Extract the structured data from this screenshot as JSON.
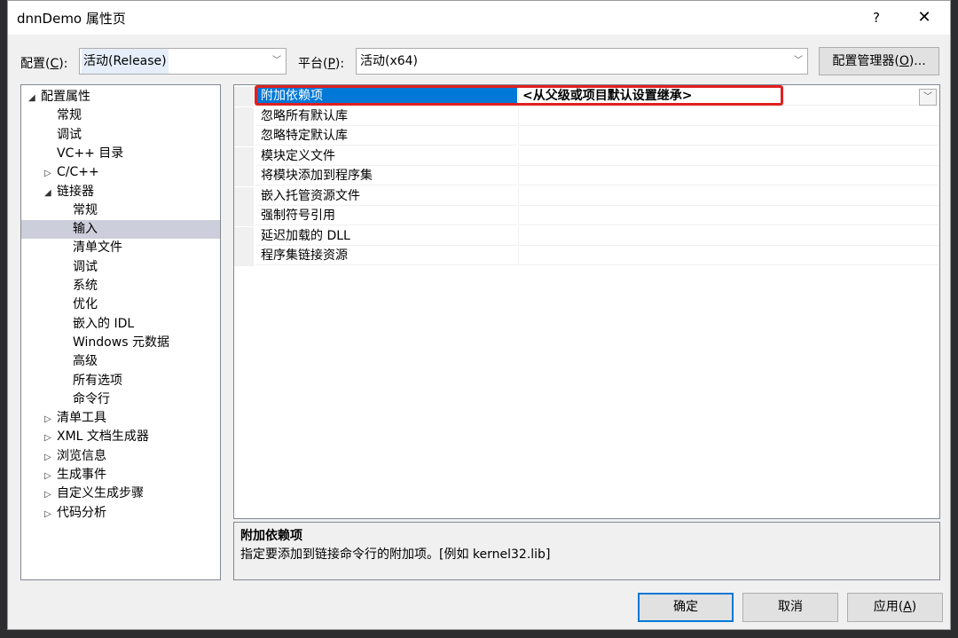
{
  "window": {
    "title": "dnnDemo 属性页",
    "help_label": "?",
    "close_label": "✕"
  },
  "toolbar": {
    "config_label": "配置(",
    "config_key": "C",
    "config_suffix": "):",
    "config_value": "活动(Release)",
    "platform_label": "平台(",
    "platform_key": "P",
    "platform_suffix": "):",
    "platform_value": "活动(x64)",
    "manager_label": "配置管理器(",
    "manager_key": "O",
    "manager_suffix": ")..."
  },
  "tree": {
    "items": [
      {
        "label": "配置属性",
        "exp": "◢",
        "level": 0
      },
      {
        "label": "常规",
        "exp": "",
        "level": 1
      },
      {
        "label": "调试",
        "exp": "",
        "level": 1
      },
      {
        "label": "VC++ 目录",
        "exp": "",
        "level": 1
      },
      {
        "label": "C/C++",
        "exp": "▷",
        "level": 1
      },
      {
        "label": "链接器",
        "exp": "◢",
        "level": 1
      },
      {
        "label": "常规",
        "exp": "",
        "level": 2
      },
      {
        "label": "输入",
        "exp": "",
        "level": 2,
        "selected": true
      },
      {
        "label": "清单文件",
        "exp": "",
        "level": 2
      },
      {
        "label": "调试",
        "exp": "",
        "level": 2
      },
      {
        "label": "系统",
        "exp": "",
        "level": 2
      },
      {
        "label": "优化",
        "exp": "",
        "level": 2
      },
      {
        "label": "嵌入的 IDL",
        "exp": "",
        "level": 2
      },
      {
        "label": "Windows 元数据",
        "exp": "",
        "level": 2
      },
      {
        "label": "高级",
        "exp": "",
        "level": 2
      },
      {
        "label": "所有选项",
        "exp": "",
        "level": 2
      },
      {
        "label": "命令行",
        "exp": "",
        "level": 2
      },
      {
        "label": "清单工具",
        "exp": "▷",
        "level": 1
      },
      {
        "label": "XML 文档生成器",
        "exp": "▷",
        "level": 1
      },
      {
        "label": "浏览信息",
        "exp": "▷",
        "level": 1
      },
      {
        "label": "生成事件",
        "exp": "▷",
        "level": 1
      },
      {
        "label": "自定义生成步骤",
        "exp": "▷",
        "level": 1
      },
      {
        "label": "代码分析",
        "exp": "▷",
        "level": 1
      }
    ]
  },
  "grid": {
    "rows": [
      {
        "name": "附加依赖项",
        "value": "<从父级或项目默认设置继承>",
        "selected": true
      },
      {
        "name": "忽略所有默认库",
        "value": ""
      },
      {
        "name": "忽略特定默认库",
        "value": ""
      },
      {
        "name": "模块定义文件",
        "value": ""
      },
      {
        "name": "将模块添加到程序集",
        "value": ""
      },
      {
        "name": "嵌入托管资源文件",
        "value": ""
      },
      {
        "name": "强制符号引用",
        "value": ""
      },
      {
        "name": "延迟加载的 DLL",
        "value": ""
      },
      {
        "name": "程序集链接资源",
        "value": ""
      }
    ]
  },
  "description": {
    "title": "附加依赖项",
    "text": "指定要添加到链接命令行的附加项。[例如 kernel32.lib]"
  },
  "buttons": {
    "ok": "确定",
    "cancel": "取消",
    "apply_label": "应用(",
    "apply_key": "A",
    "apply_suffix": ")"
  },
  "colors": {
    "selection": "#0078d7",
    "highlight_box": "#e02020",
    "tree_selection": "#cccedb"
  }
}
